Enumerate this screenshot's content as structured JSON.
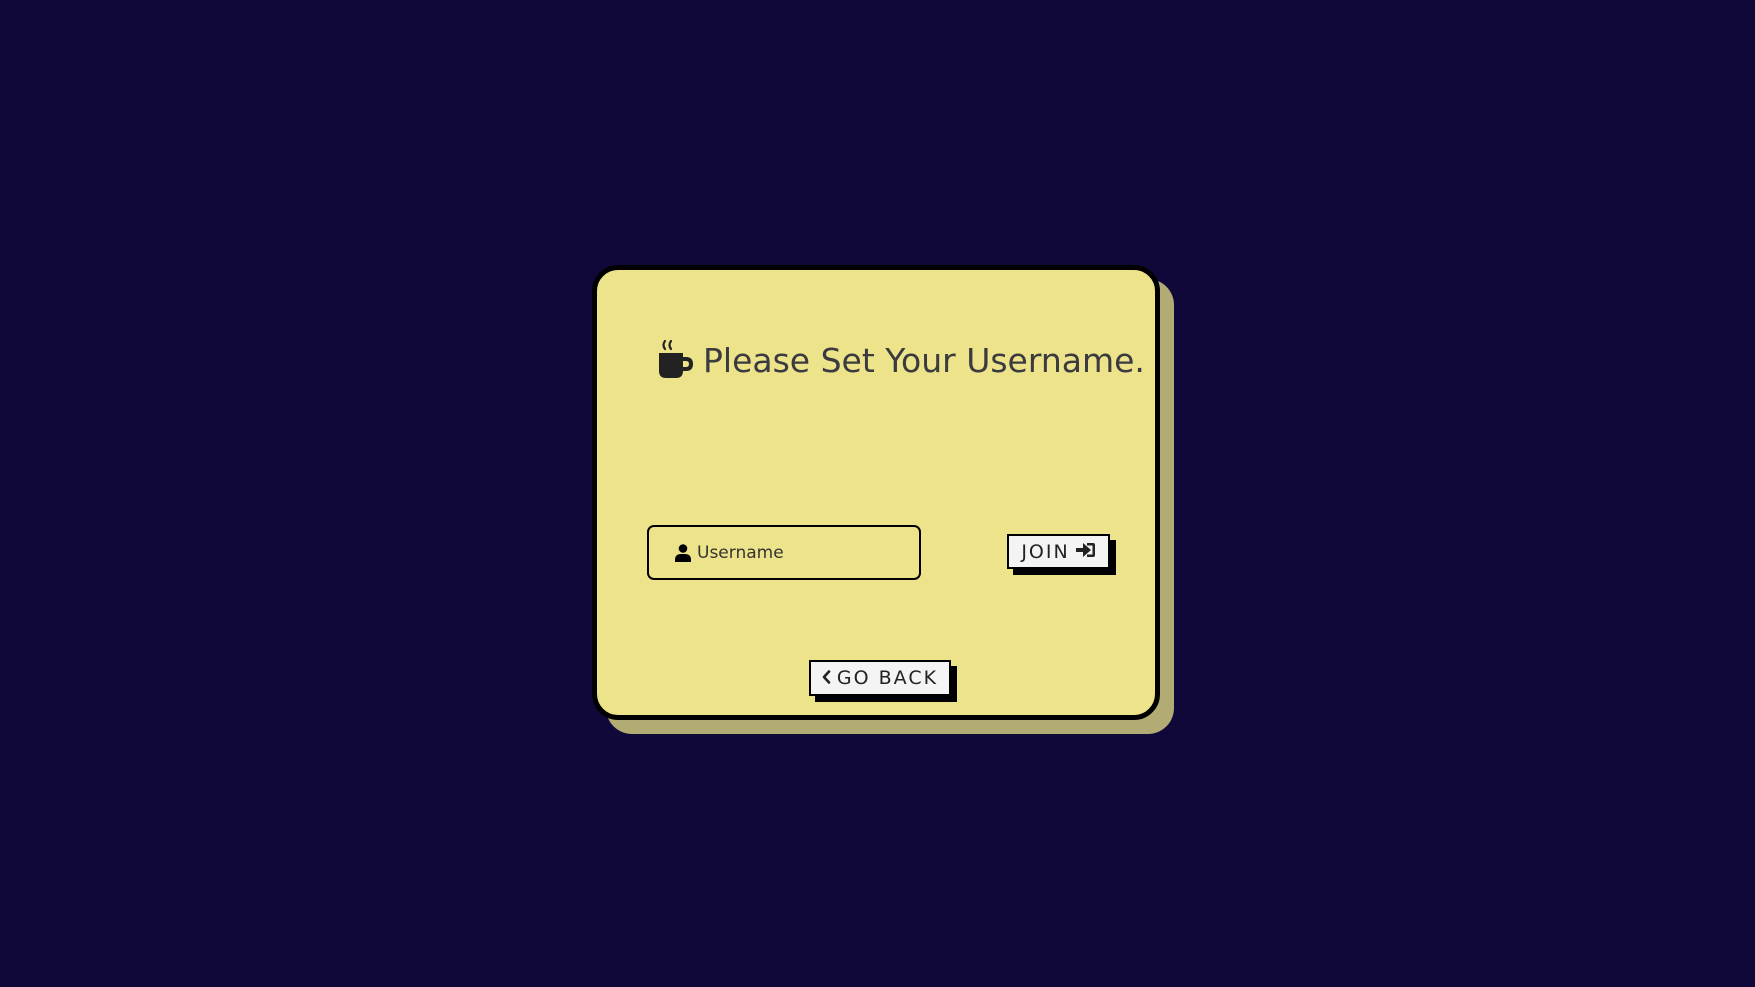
{
  "colors": {
    "background": "#100838",
    "card": "#ede38a",
    "card_shadow": "#b3ab74",
    "border": "#000000",
    "button_bg": "#f5f4f4",
    "text": "#3a3a40"
  },
  "card": {
    "title_icon": "coffee-mug-icon",
    "title": "Please Set Your Username."
  },
  "form": {
    "username_icon": "user-icon",
    "username_placeholder": "Username",
    "username_value": "",
    "join_label": "JOIN",
    "join_icon": "sign-in-icon"
  },
  "footer": {
    "back_icon": "chevron-left-icon",
    "back_label": "GO BACK"
  }
}
